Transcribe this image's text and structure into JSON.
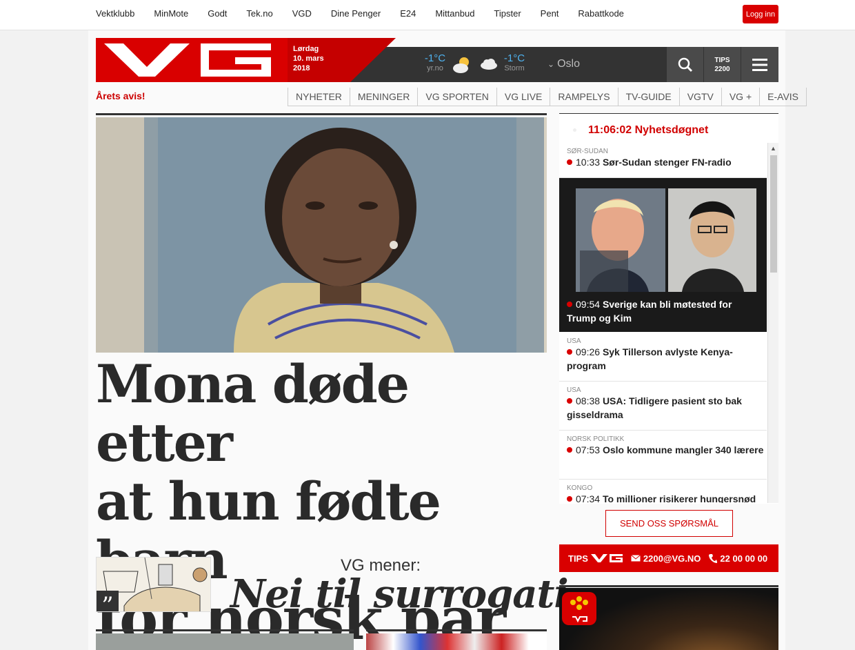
{
  "topbar": {
    "links": [
      "Vektklubb",
      "MinMote",
      "Godt",
      "Tek.no",
      "VGD",
      "Dine Penger",
      "E24",
      "Mittanbud",
      "Tipster",
      "Pent",
      "Rabattkode"
    ],
    "login": "Logg inn"
  },
  "header": {
    "day": "Lørdag",
    "date": "10. mars",
    "year": "2018",
    "weather": [
      {
        "temp": "-1°C",
        "source": "yr.no",
        "icon": "sun-cloud-icon"
      },
      {
        "temp": "-1°C",
        "source": "Storm",
        "icon": "cloud-icon"
      }
    ],
    "city": "Oslo",
    "tips_line1": "TIPS",
    "tips_line2": "2200"
  },
  "nav": {
    "arets": "Årets avis!",
    "items": [
      "NYHETER",
      "MENINGER",
      "VG SPORTEN",
      "VG LIVE",
      "RAMPELYS",
      "TV-GUIDE",
      "VGTV",
      "VG +",
      "E-AVIS"
    ]
  },
  "main": {
    "headline_l1": "Mona døde etter",
    "headline_l2": "at hun fødte barn",
    "headline_l3": "for norsk par",
    "opinion_kicker": "VG mener:",
    "opinion_title": "Nei til surrogati",
    "quote_glyph": "”"
  },
  "sidebar": {
    "title": "11:06:02 Nyhetsdøgnet",
    "items": [
      {
        "cat": "SØR-SUDAN",
        "time": "10:33",
        "text": "Sør-Sudan stenger FN-radio"
      },
      {
        "cat": "",
        "time": "09:54",
        "text": "Sverige kan bli møtested for Trump og Kim"
      },
      {
        "cat": "USA",
        "time": "09:26",
        "text": "Syk Tillerson avlyste Kenya-program"
      },
      {
        "cat": "USA",
        "time": "08:38",
        "text": "USA: Tidligere pasient sto bak gisseldrama"
      },
      {
        "cat": "NORSK POLITIKK",
        "time": "07:53",
        "text": "Oslo kommune mangler 340 lærere"
      },
      {
        "cat": "KONGO",
        "time": "07:34",
        "text": "To millioner risikerer hungersnød"
      }
    ],
    "ask_button": "SEND OSS SPØRSMÅL",
    "tips_label": "TIPS",
    "tips_email": "2200@VG.NO",
    "tips_phone": "22 00 00 00"
  },
  "colors": {
    "brand_red": "#d90000",
    "dark_bar": "#333333",
    "weather_blue": "#4fb3f0"
  }
}
